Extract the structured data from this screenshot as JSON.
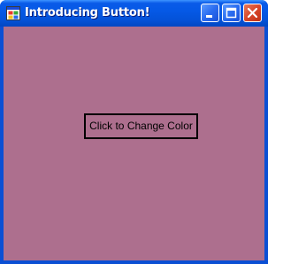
{
  "window": {
    "title": "Introducing Button!",
    "icon": "app-window-icon",
    "controls": {
      "minimize_icon": "minimize-icon",
      "maximize_icon": "maximize-icon",
      "close_icon": "close-icon"
    }
  },
  "client": {
    "background_color": "#ad6f8e",
    "button": {
      "label": "Click to Change Color"
    }
  },
  "colors": {
    "titlebar": "#0559e6",
    "close_button": "#d8472a"
  }
}
